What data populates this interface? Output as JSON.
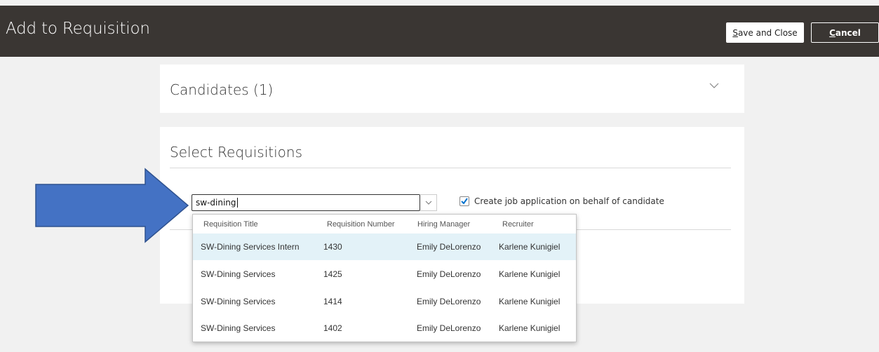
{
  "header": {
    "title": "Add to Requisition",
    "save_close_label": "Save and Close",
    "cancel_label": "Cancel"
  },
  "candidates": {
    "title": "Candidates (1)"
  },
  "requisitions": {
    "title": "Select Requisitions",
    "search_value": "sw-dining",
    "checkbox_label": "Create job application on behalf of candidate",
    "checkbox_checked": true
  },
  "dropdown": {
    "columns": [
      "Requisition Title",
      "Requisition Number",
      "Hiring Manager",
      "Recruiter"
    ],
    "rows": [
      {
        "title": "SW-Dining Services Intern",
        "number": "1430",
        "manager": "Emily DeLorenzo",
        "recruiter": "Karlene Kunigiel",
        "selected": true
      },
      {
        "title": "SW-Dining Services",
        "number": "1425",
        "manager": "Emily DeLorenzo",
        "recruiter": "Karlene Kunigiel",
        "selected": false
      },
      {
        "title": "SW-Dining Services",
        "number": "1414",
        "manager": "Emily DeLorenzo",
        "recruiter": "Karlene Kunigiel",
        "selected": false
      },
      {
        "title": "SW-Dining Services",
        "number": "1402",
        "manager": "Emily DeLorenzo",
        "recruiter": "Karlene Kunigiel",
        "selected": false
      }
    ]
  },
  "annotation": {
    "arrow_color": "#4472c4",
    "arrow_icon": "arrow-right-icon"
  },
  "colors": {
    "header_bg": "#3a3633",
    "page_bg": "#f1f1f1",
    "selected_row": "#e3f2f8",
    "checkbox_accent": "#0572ce"
  }
}
